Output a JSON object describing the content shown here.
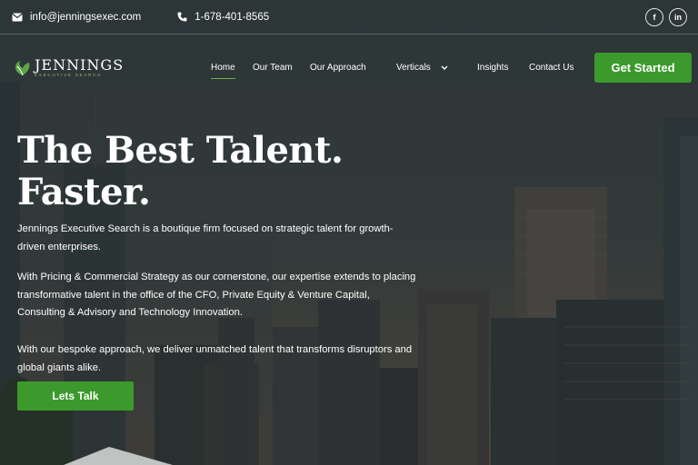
{
  "topbar": {
    "email": "info@jenningsexec.com",
    "phone": "1-678-401-8565",
    "social": [
      {
        "label": "f",
        "icon": "facebook-icon"
      },
      {
        "label": "in",
        "icon": "linkedin-icon"
      }
    ]
  },
  "logo": {
    "brand": "JENNINGS",
    "tagline": "EXECUTIVE SEARCH"
  },
  "nav": {
    "items": [
      "Home",
      "Our Team",
      "Our Approach",
      "Verticals",
      "Insights",
      "Contact Us"
    ],
    "active": "Home",
    "cta": "Get Started"
  },
  "hero": {
    "title_line1": "The Best Talent.",
    "title_line2": "Faster.",
    "p1": "Jennings Executive Search is a boutique firm focused on strategic talent for growth-driven enterprises.",
    "p2": "With Pricing & Commercial Strategy as our cornerstone, our expertise extends to placing transformative talent in the office of the CFO, Private Equity & Venture Capital, Consulting & Advisory and Technology Innovation.",
    "p3": "With our bespoke approach, we deliver unmatched talent that transforms disruptors and global giants alike.",
    "button": "Lets Talk"
  },
  "colors": {
    "accent": "#3c9a2c",
    "underline": "#6ab04c",
    "overlay": "#2b3437"
  }
}
